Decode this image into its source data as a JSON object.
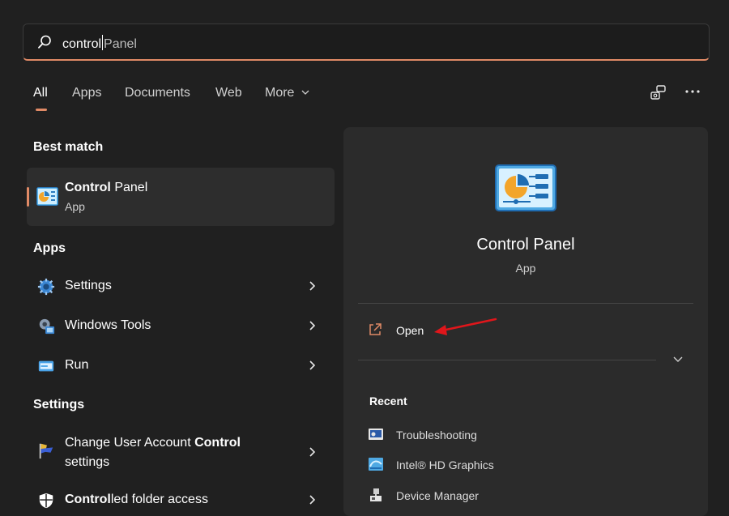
{
  "search": {
    "typed": "control",
    "suggestion": "Panel"
  },
  "tabs": [
    {
      "label": "All"
    },
    {
      "label": "Apps"
    },
    {
      "label": "Documents"
    },
    {
      "label": "Web"
    },
    {
      "label": "More"
    }
  ],
  "best_match": {
    "heading": "Best match",
    "title_bold": "Control",
    "title_rest": " Panel",
    "subtitle": "App"
  },
  "apps_section": {
    "heading": "Apps",
    "items": [
      {
        "label": "Settings",
        "icon": "settings-gear-icon"
      },
      {
        "label": "Windows Tools",
        "icon": "windows-tools-icon"
      },
      {
        "label": "Run",
        "icon": "run-icon"
      }
    ]
  },
  "settings_section": {
    "heading": "Settings",
    "items": [
      {
        "label_pre": "Change User Account ",
        "label_bold": "Control",
        "label_line2": "settings",
        "icon": "uac-flag-icon"
      },
      {
        "label_bold": "Control",
        "label_rest": "led folder access",
        "icon": "shield-icon"
      }
    ]
  },
  "detail": {
    "title": "Control Panel",
    "subtitle": "App",
    "open_label": "Open",
    "recent_heading": "Recent",
    "recent": [
      {
        "label": "Troubleshooting",
        "icon": "troubleshooting-icon"
      },
      {
        "label": "Intel® HD Graphics",
        "icon": "intel-graphics-icon"
      },
      {
        "label": "Device Manager",
        "icon": "device-manager-icon"
      }
    ]
  },
  "colors": {
    "accent": "#e08a66",
    "background": "#202020",
    "panel": "#2b2b2b",
    "annotation_arrow": "#e0161b"
  }
}
